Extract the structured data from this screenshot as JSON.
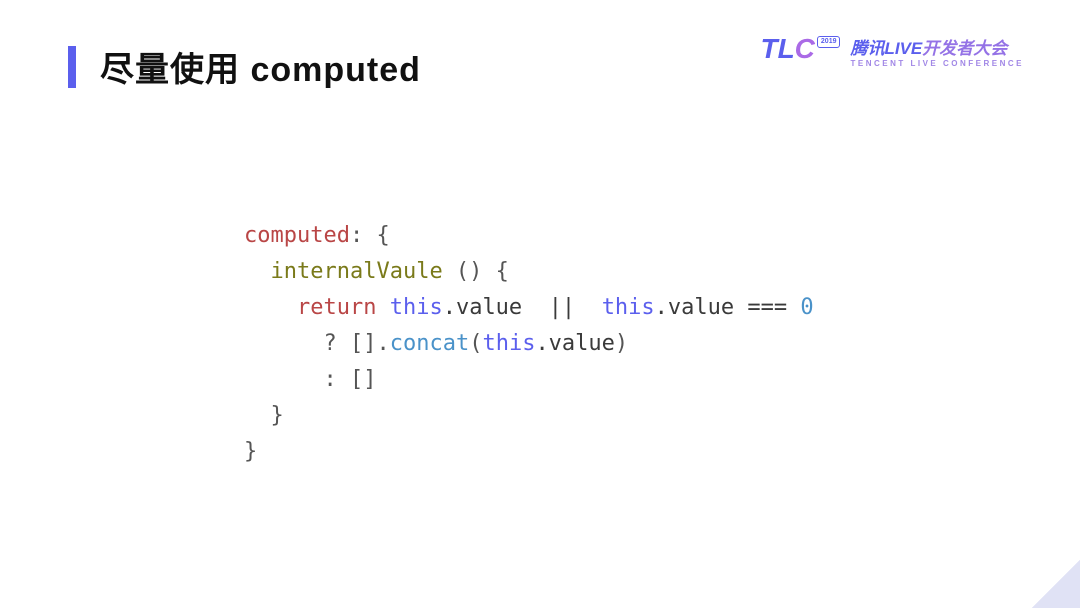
{
  "header": {
    "title": "尽量使用 computed"
  },
  "logo": {
    "brand_t": "T",
    "brand_l": "L",
    "brand_c": "C",
    "year": "2019",
    "conference_cn_a": "腾讯LIVE",
    "conference_cn_b": "开发者大会",
    "conference_en": "TENCENT LIVE CONFERENCE"
  },
  "code": {
    "prop_name": "computed",
    "open_obj": ": {",
    "fn_name": "internalVaule",
    "fn_parens": " () {",
    "kw_return": "return",
    "kw_this1": "this",
    "dot_value1": ".value",
    "op_or": "||",
    "kw_this2": "this",
    "dot_value2": ".value",
    "op_eq": "===",
    "lit_zero": "0",
    "tern_q": "? [].",
    "method_concat": "concat",
    "concat_args_open": "(",
    "kw_this3": "this",
    "dot_value3": ".value",
    "concat_args_close": ")",
    "tern_c": ": []",
    "close_fn": "}",
    "close_obj": "}"
  }
}
